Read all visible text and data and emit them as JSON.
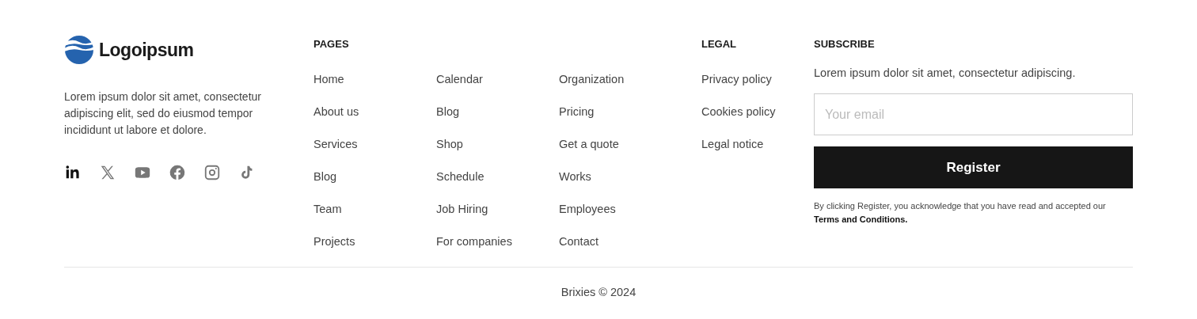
{
  "brand": {
    "name": "Logoipsum",
    "description": "Lorem ipsum dolor sit amet, consectetur adipiscing elit, sed do eiusmod tempor incididunt ut labore et dolore."
  },
  "socials": [
    {
      "kind": "linkedin",
      "selected": true
    },
    {
      "kind": "x",
      "selected": false
    },
    {
      "kind": "youtube",
      "selected": false
    },
    {
      "kind": "facebook",
      "selected": false
    },
    {
      "kind": "instagram",
      "selected": false
    },
    {
      "kind": "tiktok",
      "selected": false
    }
  ],
  "pages": {
    "title": "PAGES",
    "columns": [
      [
        "Home",
        "About us",
        "Services",
        "Blog",
        "Team",
        "Projects"
      ],
      [
        "Calendar",
        "Blog",
        "Shop",
        "Schedule",
        "Job Hiring",
        "For companies"
      ],
      [
        "Organization",
        "Pricing",
        "Get a quote",
        "Works",
        "Employees",
        "Contact"
      ]
    ]
  },
  "legal": {
    "title": "LEGAL",
    "links": [
      "Privacy policy",
      "Cookies policy",
      "Legal notice"
    ]
  },
  "subscribe": {
    "title": "SUBSCRIBE",
    "text": "Lorem ipsum dolor sit amet, consectetur adipiscing.",
    "email": {
      "placeholder": "Your email"
    },
    "button": "Register",
    "note": "By clicking Register, you acknowledge that you have read and accepted our **Terms and Conditions.**"
  },
  "copyright": "Brixies © 2024"
}
